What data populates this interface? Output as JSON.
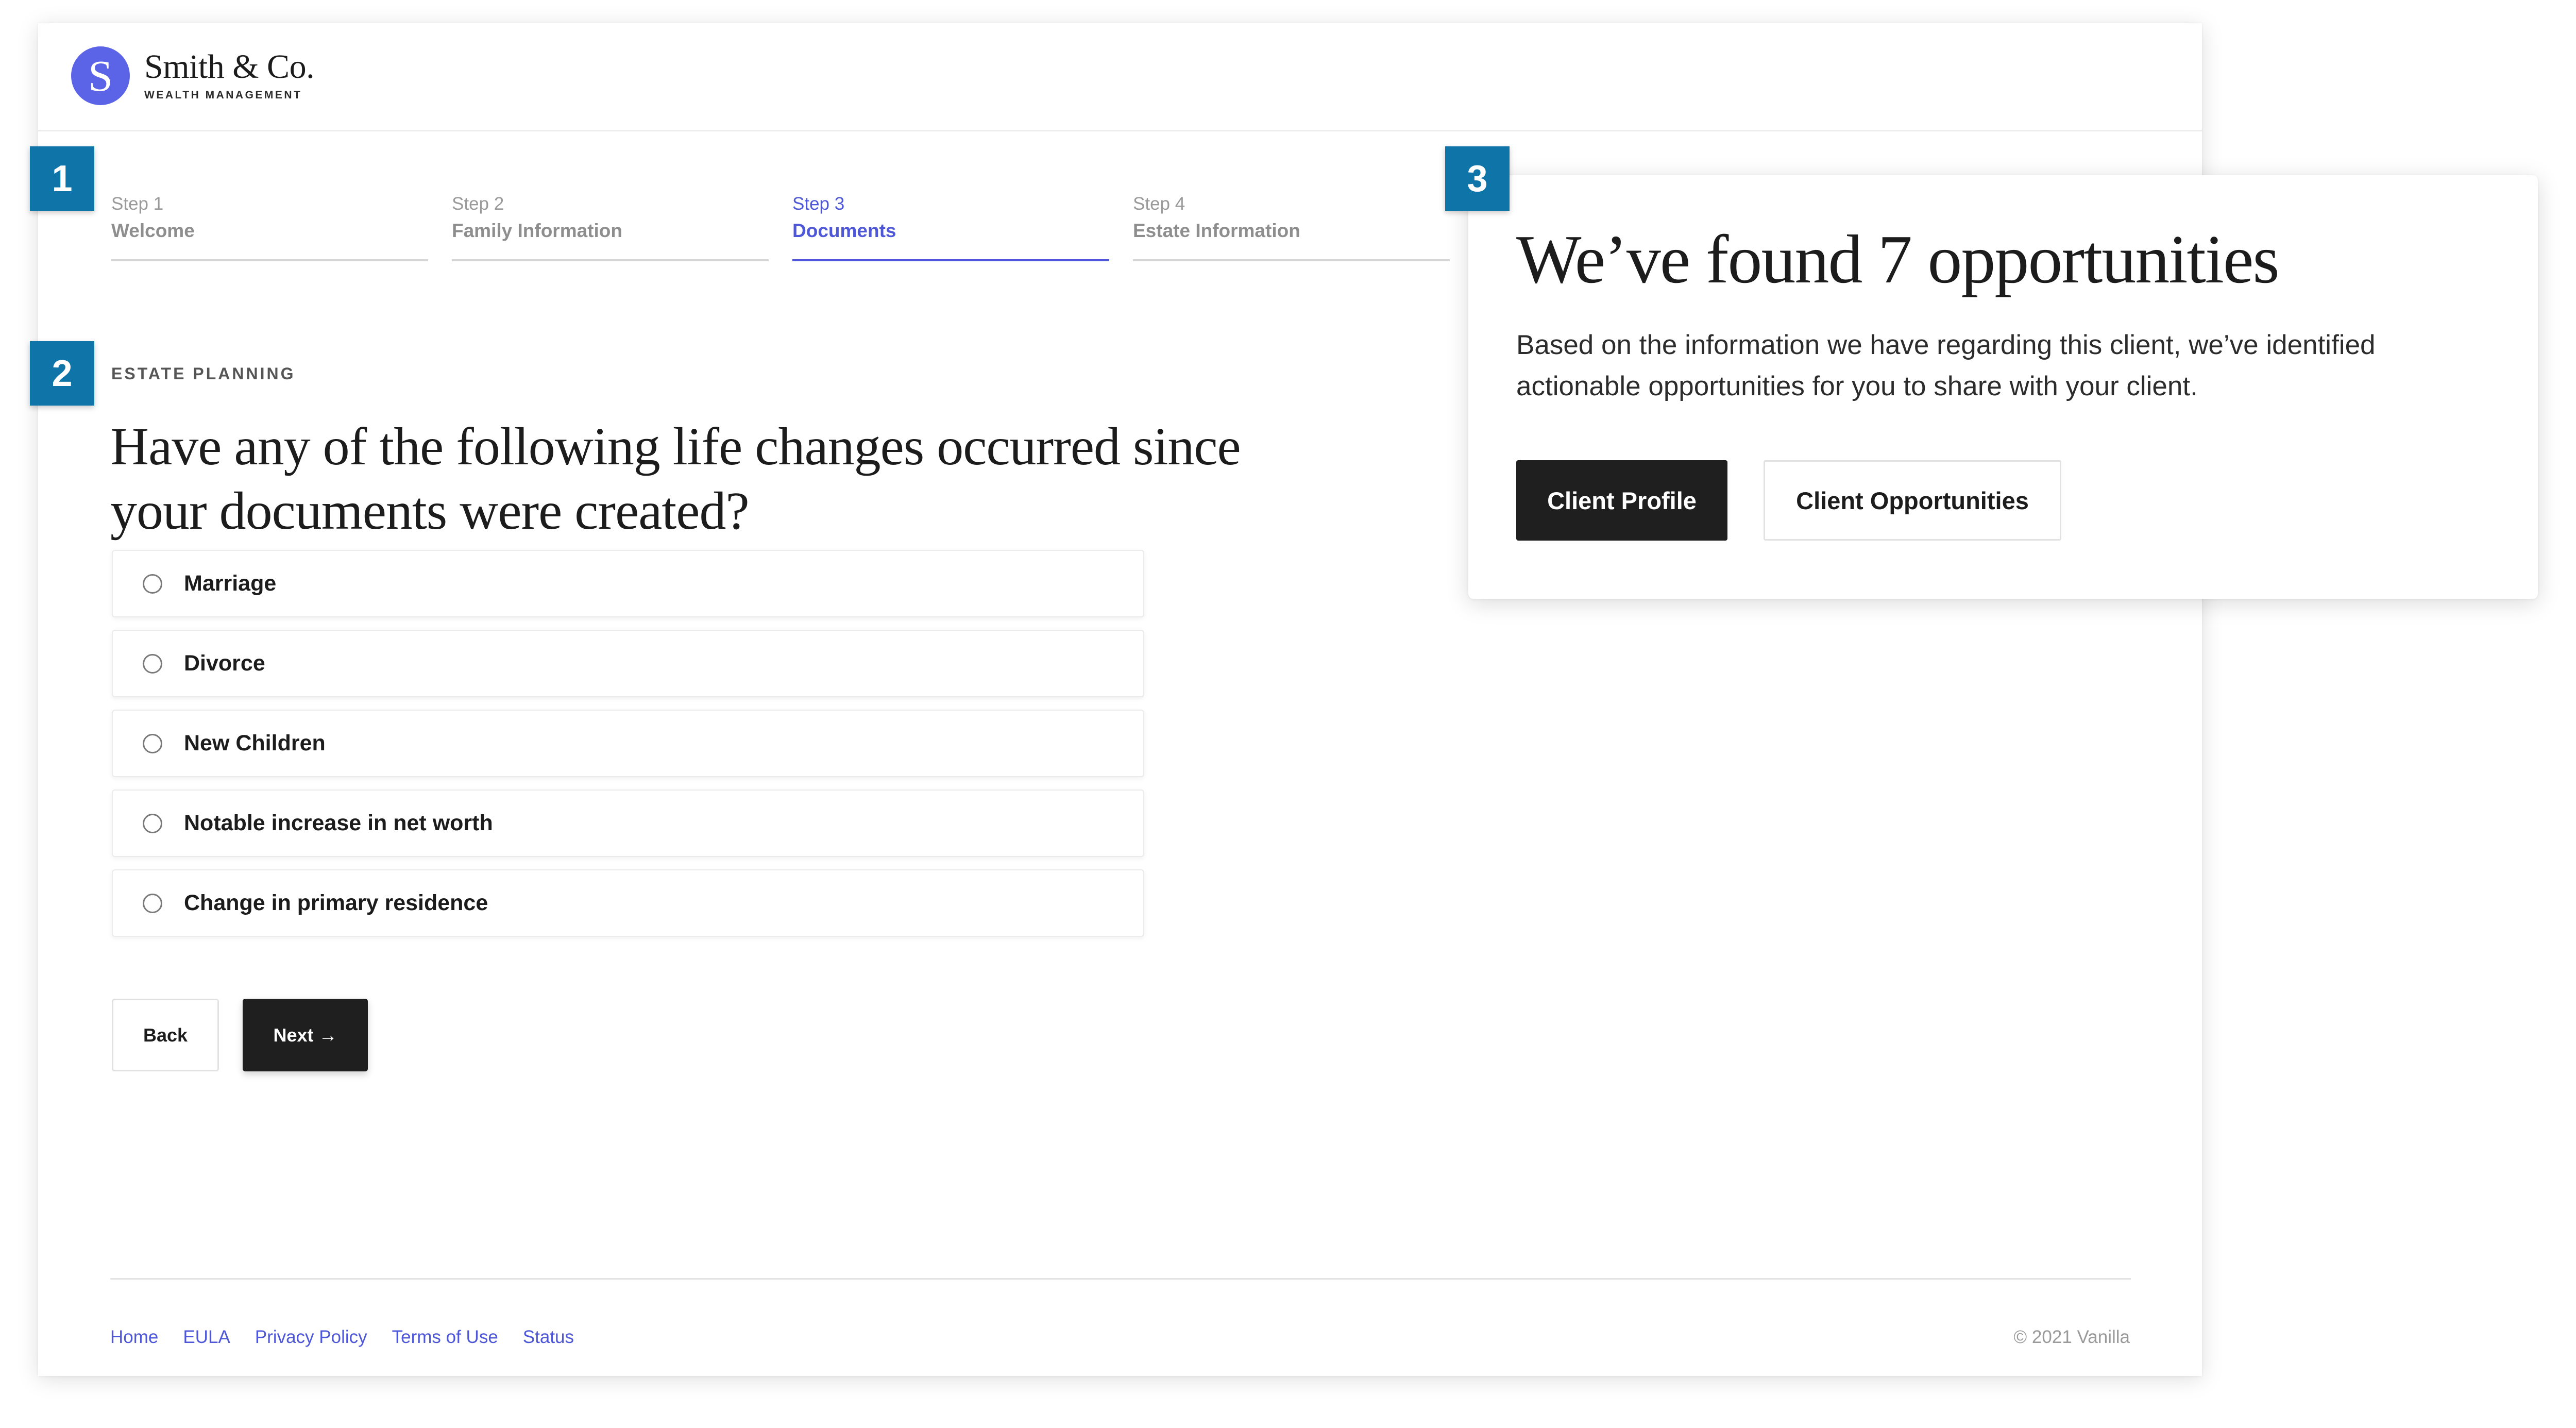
{
  "brand": {
    "logo_letter": "S",
    "name": "Smith & Co.",
    "tagline": "WEALTH MANAGEMENT",
    "logo_color": "#5b63e6"
  },
  "stepper": {
    "active_index": 2,
    "active_color": "#4e57d8",
    "steps": [
      {
        "number": "Step 1",
        "name": "Welcome"
      },
      {
        "number": "Step 2",
        "name": "Family Information"
      },
      {
        "number": "Step 3",
        "name": "Documents"
      },
      {
        "number": "Step 4",
        "name": "Estate Information"
      }
    ]
  },
  "question": {
    "eyebrow": "ESTATE PLANNING",
    "title": "Have any of the following life changes occurred since your documents were created?",
    "options": [
      {
        "label": "Marriage",
        "checked": false
      },
      {
        "label": "Divorce",
        "checked": false
      },
      {
        "label": "New Children",
        "checked": false
      },
      {
        "label": "Notable increase in net worth",
        "checked": false
      },
      {
        "label": "Change in primary residence",
        "checked": false
      }
    ]
  },
  "actions": {
    "back_label": "Back",
    "next_label": "Next →"
  },
  "footer": {
    "links": [
      "Home",
      "EULA",
      "Privacy Policy",
      "Terms of Use",
      "Status"
    ],
    "copyright": "© 2021 Vanilla"
  },
  "opportunities_card": {
    "title": "We’ve found 7 opportunities",
    "description": "Based on the information we have regarding this client, we’ve identified actionable opportunities for you to share with your client.",
    "primary_button": "Client Profile",
    "secondary_button": "Client Opportunities"
  },
  "callouts": [
    "1",
    "2",
    "3"
  ],
  "colors": {
    "accent": "#4e57d8",
    "callout": "#0f75a8",
    "dark_button": "#1f1f1f"
  }
}
